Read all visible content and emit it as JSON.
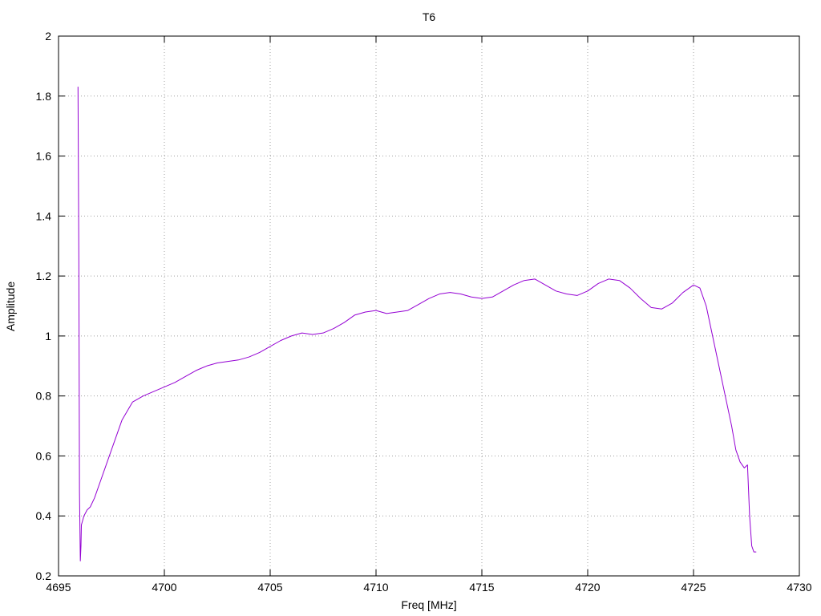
{
  "chart_data": {
    "type": "line",
    "title": "T6",
    "xlabel": "Freq [MHz]",
    "ylabel": "Amplitude",
    "xlim": [
      4695,
      4730
    ],
    "ylim": [
      0.2,
      2.0
    ],
    "x_ticks": [
      4695,
      4700,
      4705,
      4710,
      4715,
      4720,
      4725,
      4730
    ],
    "y_ticks": [
      0.2,
      0.4,
      0.6,
      0.8,
      1.0,
      1.2,
      1.4,
      1.6,
      1.8,
      2.0
    ],
    "x_tick_labels": [
      "4695",
      "4700",
      "4705",
      "4710",
      "4715",
      "4720",
      "4725",
      "4730"
    ],
    "y_tick_labels": [
      "0.2",
      "0.4",
      "0.6",
      "0.8",
      "1",
      "1.2",
      "1.4",
      "1.6",
      "1.8",
      "2"
    ],
    "grid": true,
    "legend": "none",
    "series": [
      {
        "color": "#9400d3",
        "x": [
          4695.92,
          4695.96,
          4695.99,
          4696.03,
          4696.06,
          4696.08,
          4696.12,
          4696.2,
          4696.35,
          4696.5,
          4696.7,
          4697.0,
          4697.5,
          4698.0,
          4698.5,
          4699.0,
          4699.5,
          4700.0,
          4700.5,
          4701.0,
          4701.5,
          4702.0,
          4702.5,
          4703.0,
          4703.5,
          4704.0,
          4704.5,
          4705.0,
          4705.5,
          4706.0,
          4706.5,
          4707.0,
          4707.5,
          4708.0,
          4708.5,
          4709.0,
          4709.5,
          4710.0,
          4710.5,
          4711.0,
          4711.5,
          4712.0,
          4712.5,
          4713.0,
          4713.5,
          4714.0,
          4714.5,
          4715.0,
          4715.5,
          4716.0,
          4716.5,
          4717.0,
          4717.5,
          4718.0,
          4718.5,
          4719.0,
          4719.5,
          4720.0,
          4720.5,
          4721.0,
          4721.5,
          4722.0,
          4722.5,
          4723.0,
          4723.5,
          4724.0,
          4724.5,
          4725.0,
          4725.3,
          4725.6,
          4725.9,
          4726.2,
          4726.5,
          4726.8,
          4727.0,
          4727.2,
          4727.4,
          4727.55,
          4727.65,
          4727.75,
          4727.85,
          4727.95
        ],
        "y": [
          1.83,
          1.25,
          0.48,
          0.25,
          0.3,
          0.37,
          0.38,
          0.4,
          0.42,
          0.43,
          0.46,
          0.52,
          0.62,
          0.72,
          0.78,
          0.8,
          0.815,
          0.83,
          0.845,
          0.865,
          0.885,
          0.9,
          0.91,
          0.915,
          0.92,
          0.93,
          0.945,
          0.965,
          0.985,
          1.0,
          1.01,
          1.005,
          1.01,
          1.025,
          1.045,
          1.07,
          1.08,
          1.085,
          1.075,
          1.08,
          1.085,
          1.105,
          1.125,
          1.14,
          1.145,
          1.14,
          1.13,
          1.125,
          1.13,
          1.15,
          1.17,
          1.185,
          1.19,
          1.17,
          1.15,
          1.14,
          1.135,
          1.15,
          1.175,
          1.19,
          1.185,
          1.16,
          1.125,
          1.095,
          1.09,
          1.11,
          1.145,
          1.17,
          1.16,
          1.1,
          1.0,
          0.9,
          0.8,
          0.7,
          0.62,
          0.58,
          0.56,
          0.57,
          0.4,
          0.3,
          0.28,
          0.28
        ]
      }
    ]
  }
}
